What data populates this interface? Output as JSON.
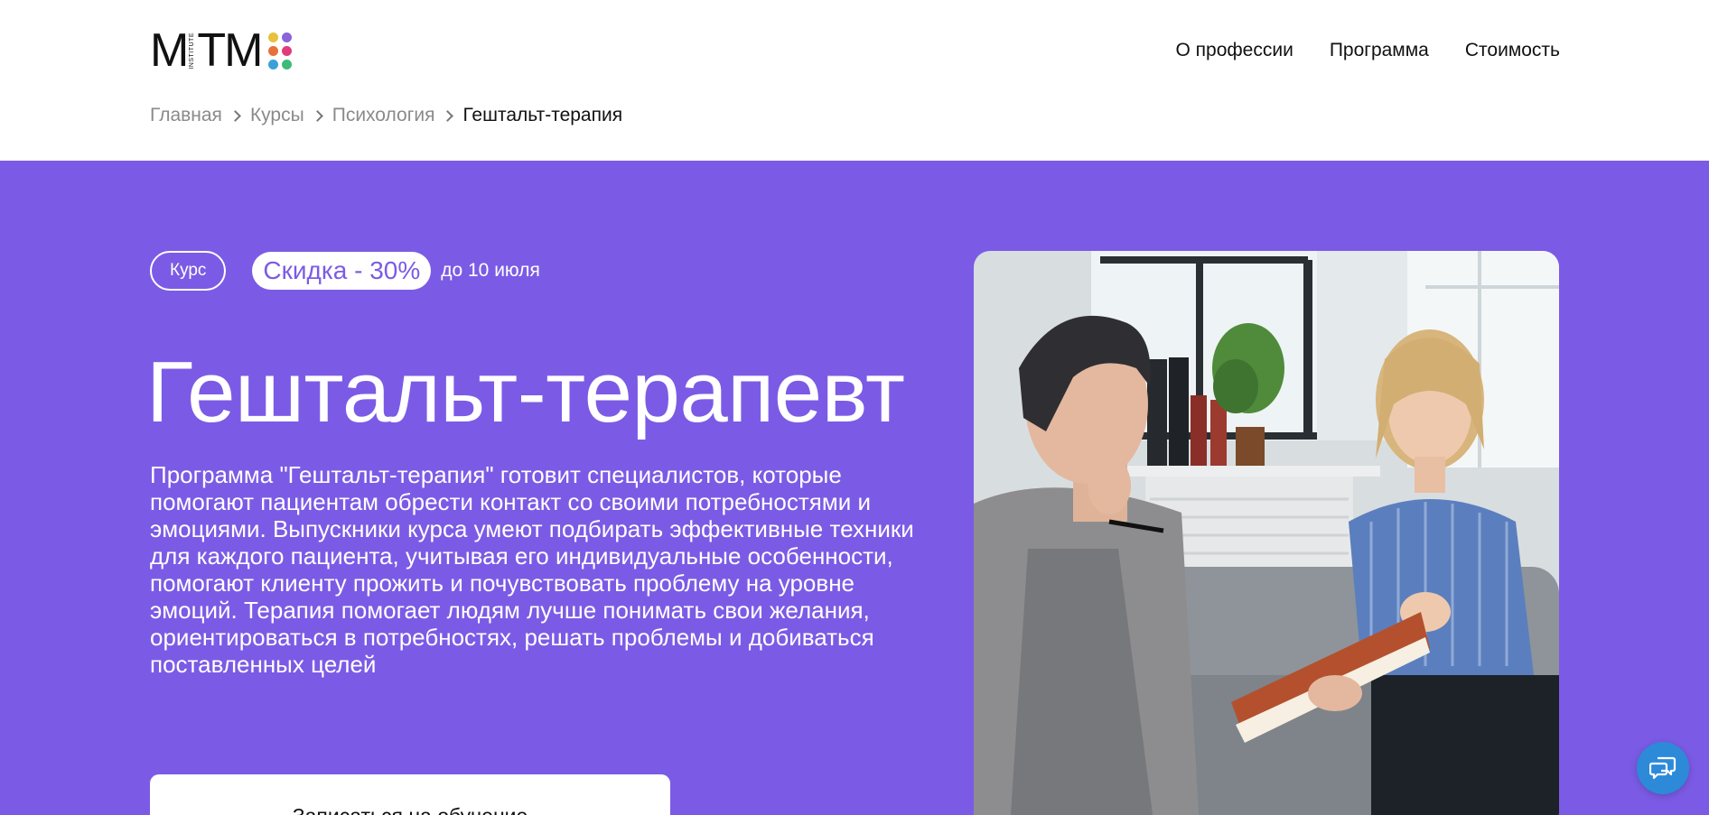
{
  "logo": {
    "text_m": "M",
    "text_institute": "INSTITUTE",
    "text_tm": "TM",
    "dot_colors": [
      "#e8c13a",
      "#8a64d8",
      "#e8703a",
      "#e23b7a",
      "#3aa0d8",
      "#3dbb78"
    ]
  },
  "nav": {
    "items": [
      {
        "label": "О профессии"
      },
      {
        "label": "Программа"
      },
      {
        "label": "Стоимость"
      }
    ]
  },
  "breadcrumb": {
    "items": [
      {
        "label": "Главная"
      },
      {
        "label": "Курсы"
      },
      {
        "label": "Психология"
      },
      {
        "label": "Гештальт-терапия"
      }
    ]
  },
  "hero": {
    "background": "#7b5be5",
    "tag_course": "Курс",
    "tag_discount": "Скидка - 30%",
    "tag_until": "до 10 июля",
    "title": "Гештальт-терапевт",
    "description": "Программа \"Гештальт-терапия\" готовит специалистов, которые помогают пациентам обрести контакт со своими потребностями и эмоциями. Выпускники курса умеют подбирать эффективные техники для каждого пациента, учитывая его индивидуальные особенности, помогают клиенту прожить и почувствовать проблему на уровне эмоций. Терапия помогает людям лучше понимать свои желания, ориентироваться в потребностях, решать проблемы и добиваться поставленных целей",
    "cta_label": "Записаться на обучение"
  },
  "chat": {
    "color": "#2c8ad9",
    "icon": "chat-bubbles-icon"
  }
}
